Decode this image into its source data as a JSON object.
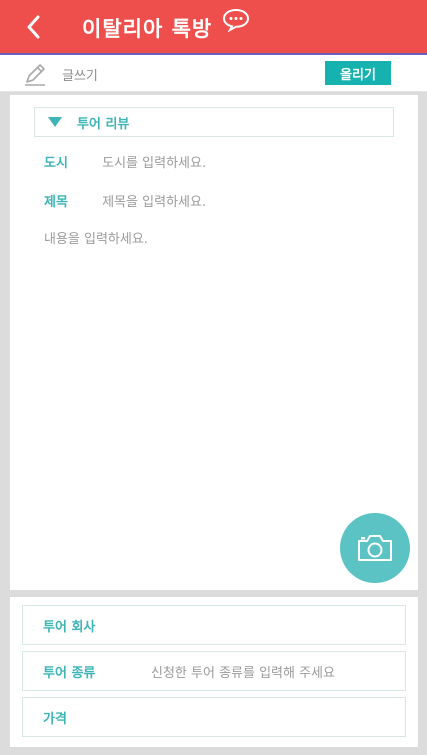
{
  "header": {
    "title": "이탈리아  톡방",
    "back_icon": "chevron-left-icon",
    "chat_icon": "speech-bubble-icon",
    "color": "#ef4f4c"
  },
  "toolbar": {
    "write_label": "글쓰기",
    "upload_label": "올리기",
    "pencil_icon": "pencil-icon",
    "accent": "#16b2b0"
  },
  "form": {
    "category": {
      "selected": "투어 리뷰",
      "icon": "triangle-down-icon"
    },
    "city": {
      "label": "도시",
      "placeholder": "도시를 입력하세요."
    },
    "subject": {
      "label": "제목",
      "placeholder": "제목을 입력하세요."
    },
    "body": {
      "placeholder": "내용을 입력하세요."
    },
    "camera_icon": "camera-icon"
  },
  "details": {
    "company": {
      "label": "투어 회사",
      "value": ""
    },
    "tour_type": {
      "label": "투어 종류",
      "placeholder": "신청한 투어 종류를 입력해 주세요"
    },
    "price": {
      "label": "가격",
      "value": ""
    }
  }
}
